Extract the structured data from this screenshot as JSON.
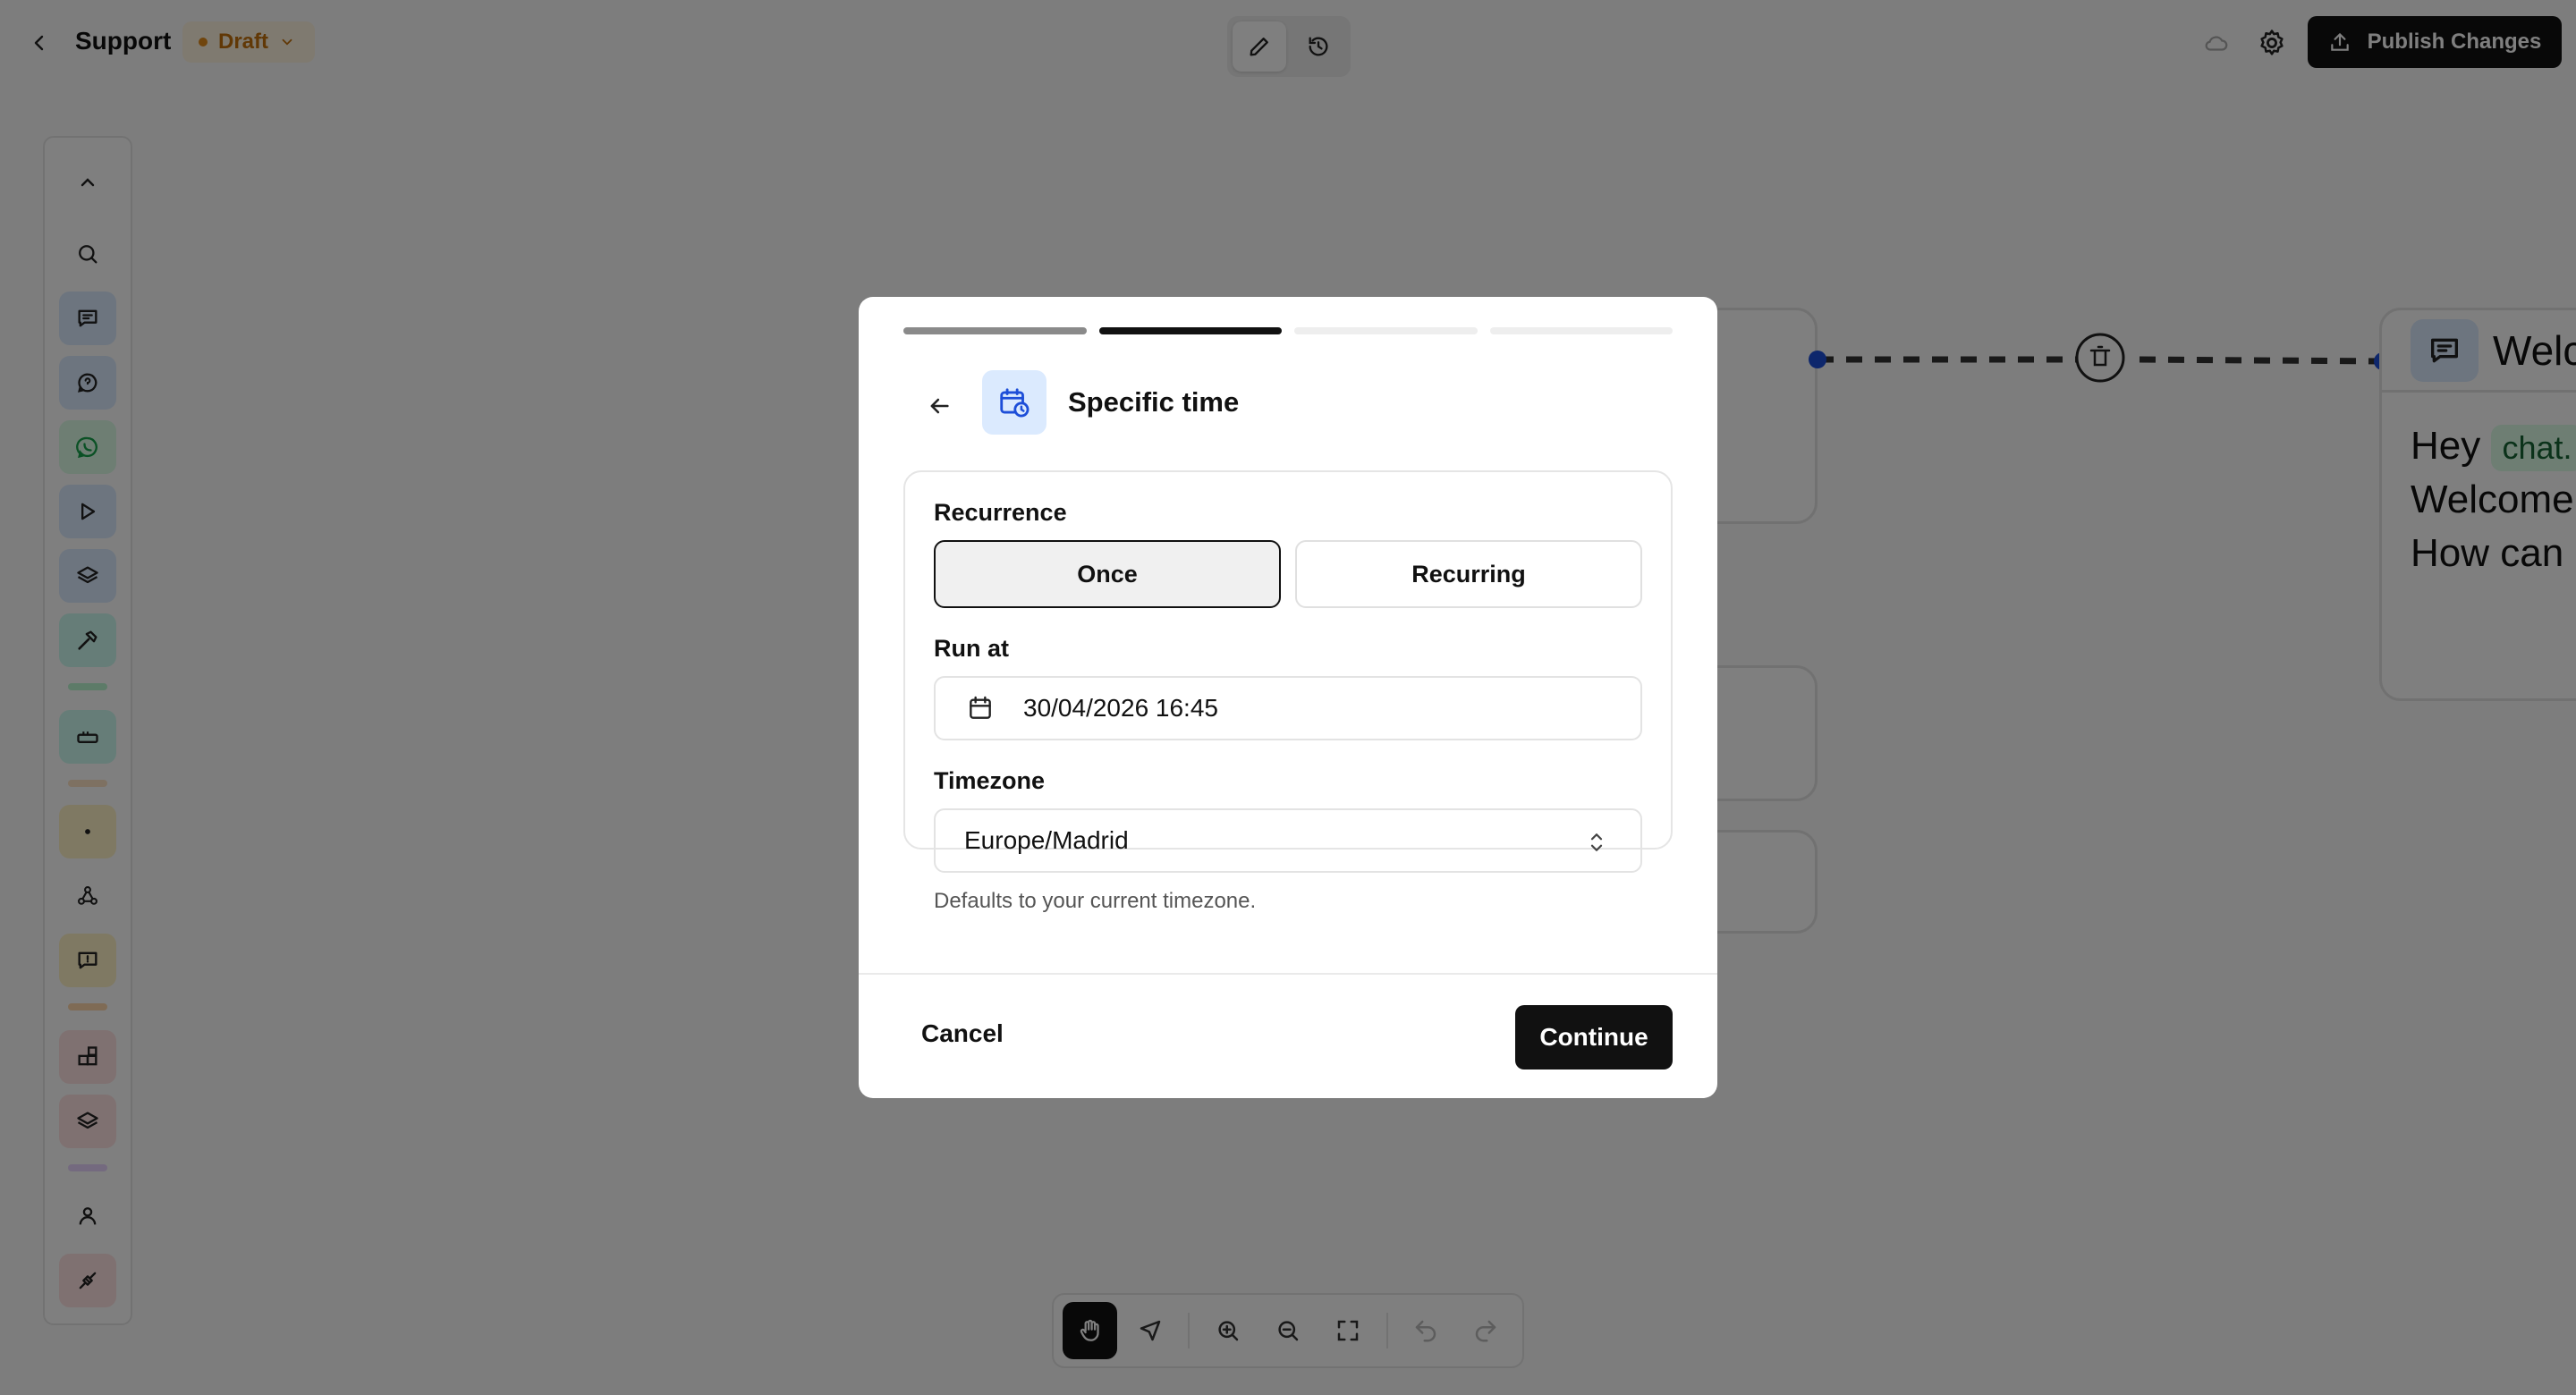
{
  "header": {
    "title": "Support",
    "status": "Draft",
    "publish_label": "Publish Changes"
  },
  "canvas": {
    "welcome_node": {
      "title": "Welc",
      "line1_prefix": "Hey",
      "line1_chip": "chat.",
      "line2": "Welcome",
      "line3": "How can"
    }
  },
  "modal": {
    "title": "Specific time",
    "steps_total": 4,
    "current_step": 2,
    "recurrence_label": "Recurrence",
    "once_label": "Once",
    "recurring_label": "Recurring",
    "selected_recurrence": "Once",
    "run_at_label": "Run at",
    "run_at_value": "30/04/2026 16:45",
    "timezone_label": "Timezone",
    "timezone_value": "Europe/Madrid",
    "timezone_help": "Defaults to your current timezone.",
    "cancel_label": "Cancel",
    "continue_label": "Continue"
  },
  "colors": {
    "accent": "#111111",
    "draft": "#c2710c",
    "node_blue": "#1d4ed8"
  }
}
